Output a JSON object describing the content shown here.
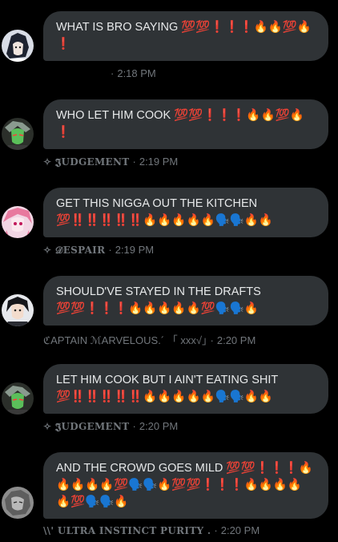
{
  "messages": [
    {
      "text": "WHAT IS BRO SAYING 💯💯❗❗❗🔥🔥💯🔥❗",
      "sender": "",
      "time": "2:18 PM",
      "avatar": "anime-character-avatar"
    },
    {
      "text": "WHO LET HIM COOK 💯💯❗❗❗🔥🔥💯🔥❗",
      "sender": "✧ 𝕵UDGEMENT",
      "time": "2:19 PM",
      "avatar": "green-character-avatar"
    },
    {
      "text": "GET THIS NIGGA OUT THE KITCHEN 💯‼️‼️‼️‼️‼️🔥🔥🔥🔥🔥🗣️🗣️🔥🔥",
      "sender": "✧ 𝒟ESPAIR",
      "time": "2:19 PM",
      "avatar": "pink-hair-avatar"
    },
    {
      "text": "SHOULD'VE STAYED IN THE DRAFTS 💯💯❗❗❗🔥🔥🔥🔥🔥💯🗣️🗣️🔥",
      "sender": "ℭAPTAIN ℳARVELOUS.´ 「 xxx√」",
      "time": "2:20 PM",
      "avatar": "dark-hair-avatar"
    },
    {
      "text": "LET HIM COOK BUT I AIN'T EATING SHIT 💯‼️‼️‼️‼️‼️🔥🔥🔥🔥🔥🗣️🗣️🔥🔥",
      "sender": "✧ 𝕵UDGEMENT",
      "time": "2:20 PM",
      "avatar": "green-character-avatar"
    },
    {
      "text": "AND THE CROWD GOES MILD 💯💯❗❗❗🔥🔥🔥🔥🔥💯🗣️🗣️🔥💯💯❗❗❗🔥🔥🔥🔥🔥💯🗣️🗣️🔥",
      "sender": "\\\\' ULTRA INSTINCT PURITY .",
      "time": "2:20 PM",
      "avatar": "gray-sketch-avatar"
    }
  ]
}
